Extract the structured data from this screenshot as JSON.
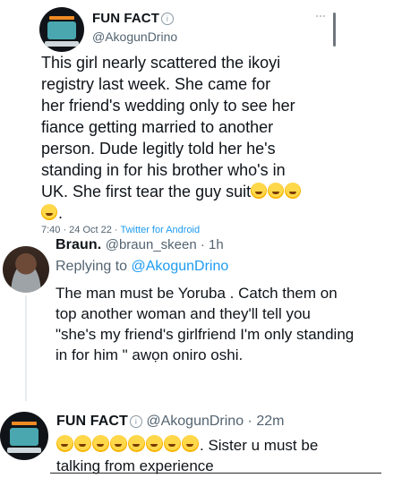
{
  "tweet": {
    "name": "FUN FACT",
    "handle": "@AkogunDrino",
    "lines": [
      "This girl nearly scattered the ikoyi",
      "registry last week. She came for",
      "her friend's wedding only to see her",
      "fiance getting married to another",
      "person. Dude legitly told her he's",
      "standing in for his brother who's in",
      "UK. She first tear the guy suit"
    ],
    "line8_suffix": ".",
    "time": "7:40 · 24 Oct 22 · ",
    "source": "Twitter for Android"
  },
  "reply": {
    "name": "Braun.",
    "handle_time": "@braun_skeen · 1h",
    "replying_prefix": "Replying to ",
    "replying_to": "@AkogunDrino",
    "lines": [
      "The man must be Yoruba . Catch them on",
      "top another woman and they'll tell you",
      "\"she's my friend's girlfriend I'm only standing",
      "in for him \" awọn oniro oshi."
    ]
  },
  "reply2": {
    "name": "FUN FACT",
    "handle_time": "@AkogunDrino · 22m",
    "line1_suffix": ". Sister u must be",
    "line2": "talking from experience"
  },
  "icons": {
    "laughing_emoji": "face-with-tears-of-joy",
    "verified": "info-circle-icon",
    "more": "more-dots-icon"
  },
  "colors": {
    "link": "#1d9bf0",
    "handle": "#536471"
  }
}
